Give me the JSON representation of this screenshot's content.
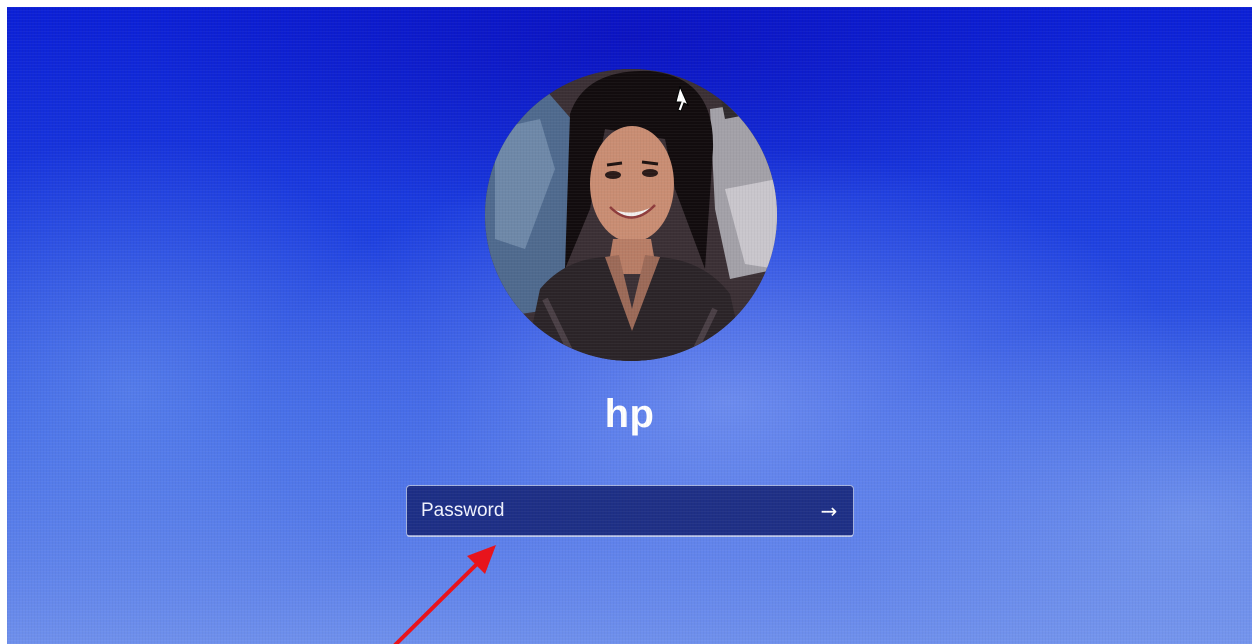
{
  "lock_screen": {
    "username": "hp",
    "password_field": {
      "placeholder": "Password",
      "value": ""
    },
    "submit_icon": "arrow-right-icon",
    "submit_glyph": "→"
  },
  "colors": {
    "background_blue": "#1d3fe0",
    "field_background": "#162478",
    "text": "#ffffff",
    "annotation_arrow": "#e8141c"
  }
}
